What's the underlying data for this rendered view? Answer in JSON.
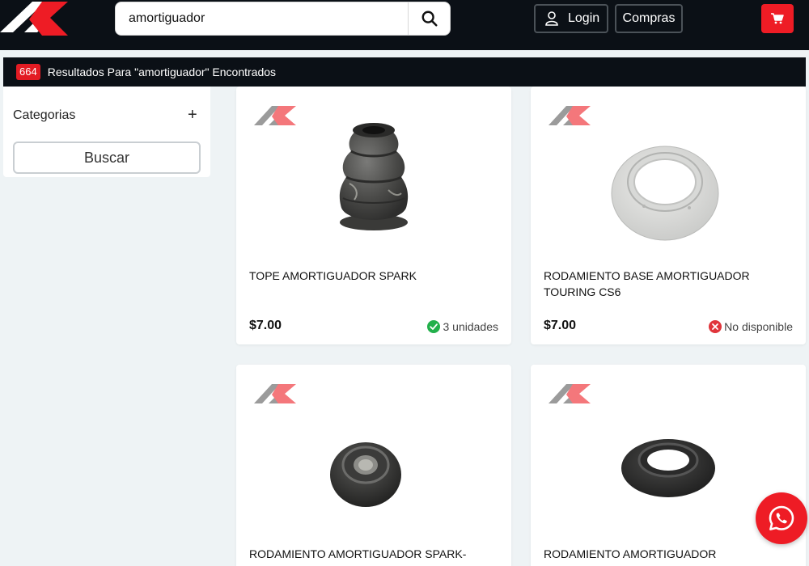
{
  "header": {
    "search_value": "amortiguador",
    "login_label": "Login",
    "compras_label": "Compras"
  },
  "results": {
    "count": "664",
    "text": "Resultados Para \"amortiguador\" Encontrados"
  },
  "sidebar": {
    "categories_label": "Categorias",
    "expand_symbol": "+",
    "search_button": "Buscar"
  },
  "products": [
    {
      "name": "TOPE AMORTIGUADOR SPARK",
      "price": "$7.00",
      "stock": "3 unidades",
      "available": true
    },
    {
      "name": "RODAMIENTO BASE AMORTIGUADOR TOURING CS6",
      "price": "$7.00",
      "stock": "No disponible",
      "available": false
    },
    {
      "name": "RODAMIENTO AMORTIGUADOR SPARK-AVEO",
      "price": "",
      "stock": "",
      "available": null
    },
    {
      "name": "RODAMIENTO AMORTIGUADOR",
      "price": "",
      "stock": "",
      "available": null
    }
  ],
  "colors": {
    "brand_red": "#ee1c25",
    "header_dark": "#0b1016",
    "available_green": "#22b04b",
    "unavailable_red": "#e0353b"
  },
  "icons": {
    "search": "search-icon",
    "user": "user-icon",
    "cart": "cart-icon",
    "whatsapp": "whatsapp-icon",
    "check": "check-circle-icon",
    "cross": "x-circle-icon"
  }
}
